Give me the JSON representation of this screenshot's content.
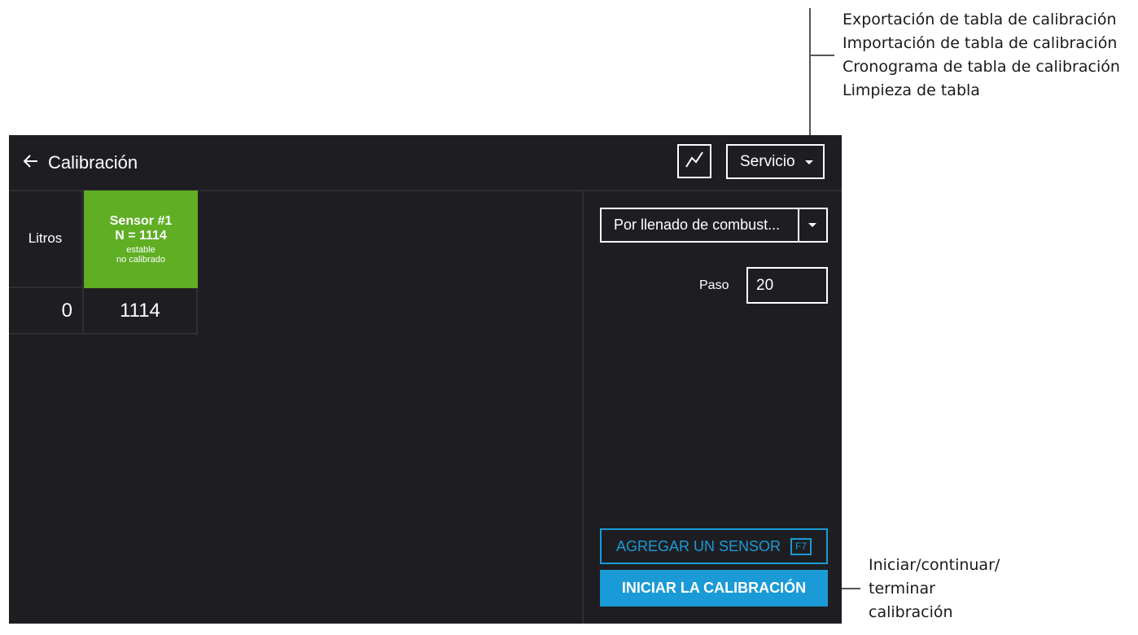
{
  "callouts": {
    "service_menu": [
      "Exportación de tabla de calibración",
      "Importación de tabla de calibración",
      "Cronograma de tabla de calibración",
      "Limpieza de tabla"
    ],
    "start_button": [
      "Iniciar/continuar/",
      "terminar",
      "calibración"
    ]
  },
  "header": {
    "back_icon": "arrow-left-icon",
    "title": "Calibración",
    "chart_icon": "line-chart-icon",
    "service_label": "Servicio"
  },
  "table": {
    "column_header": "Litros",
    "sensor": {
      "name": "Sensor #1",
      "n_value": "N = 1114",
      "state": "estable",
      "calibration_state": "no calibrado",
      "color": "#5fae24"
    },
    "rows": [
      {
        "litros": "0",
        "sensor_value": "1114"
      }
    ]
  },
  "side": {
    "mode_value": "Por llenado de combust...",
    "step_label": "Paso",
    "step_value": "20",
    "add_sensor_label": "AGREGAR UN SENSOR",
    "add_sensor_shortcut": "F7",
    "start_label": "INICIAR LA CALIBRACIÓN"
  },
  "colors": {
    "background": "#1e1e22",
    "accent": "#1a9ad6",
    "sensor_ok": "#5fae24"
  }
}
